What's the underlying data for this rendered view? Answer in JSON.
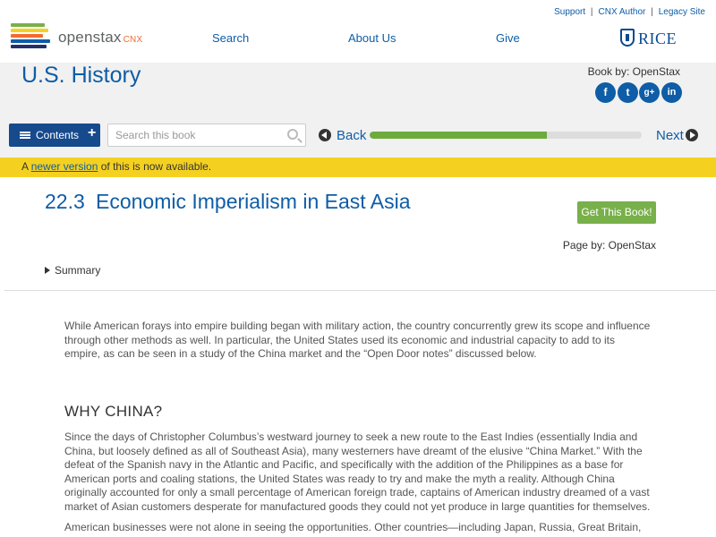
{
  "header": {
    "logo_text": "openstax",
    "logo_suffix": "CNX",
    "utility_links": [
      "Support",
      "CNX Author",
      "Legacy Site"
    ],
    "nav": [
      "Search",
      "About Us",
      "Give"
    ],
    "partner": "RICE",
    "logo_bar_colors": [
      "#78b04a",
      "#f4d121",
      "#f36b32",
      "#0e5da6",
      "#233067"
    ]
  },
  "book": {
    "title": "U.S. History",
    "book_by": "Book by: OpenStax",
    "social": [
      "facebook-icon",
      "twitter-icon",
      "google-plus-icon",
      "linkedin-icon"
    ],
    "social_glyphs": [
      "f",
      "t",
      "g+",
      "in"
    ]
  },
  "toolbar": {
    "contents_label": "Contents",
    "search_placeholder": "Search this book",
    "back_label": "Back",
    "next_label": "Next",
    "progress_fraction": 0.65
  },
  "notice": {
    "prefix": "A ",
    "link": "newer version",
    "suffix": " of this is now available."
  },
  "page": {
    "section_number": "22.3",
    "section_title": "Economic Imperialism in East Asia",
    "get_book_label": "Get This Book!",
    "page_by": "Page by: OpenStax",
    "summary_label": "Summary"
  },
  "content": {
    "intro": "While American forays into empire building began with military action, the country concurrently grew its scope and influence through other methods as well. In particular, the United States used its economic and industrial capacity to add to its empire, as can be seen in a study of the China market and the “Open Door notes” discussed below.",
    "heading": "WHY CHINA?",
    "para1": "Since the days of Christopher Columbus’s westward journey to seek a new route to the East Indies (essentially India and China, but loosely defined as all of Southeast Asia), many westerners have dreamt of the elusive “China Market.” With the defeat of the Spanish navy in the Atlantic and Pacific, and specifically with the addition of the Philippines as a base for American ports and coaling stations, the United States was ready to try and make the myth a reality. Although China originally accounted for only a small percentage of American foreign trade, captains of American industry dreamed of a vast market of Asian customers desperate for manufactured goods they could not yet produce in large quantities for themselves.",
    "para2": "American businesses were not alone in seeing the opportunities. Other countries—including Japan, Russia, Great Britain, France, and"
  },
  "colors": {
    "link_blue": "#0e5da6",
    "contents_blue": "#174a8c",
    "progress_green": "#6dab3c",
    "button_green": "#78b04a",
    "notice_yellow": "#f4d121"
  }
}
